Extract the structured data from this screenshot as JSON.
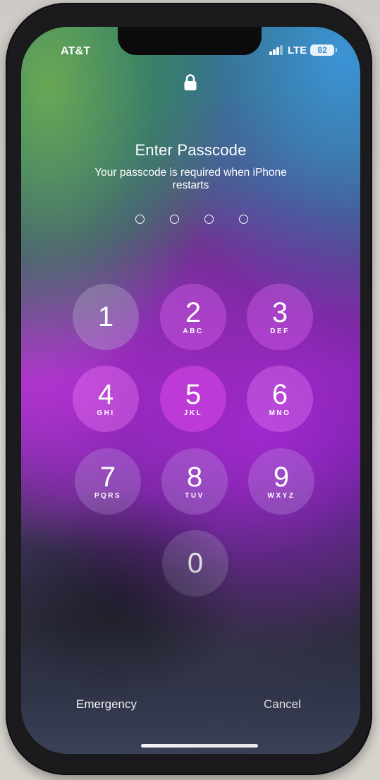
{
  "status_bar": {
    "carrier": "AT&T",
    "network": "LTE",
    "battery": "82"
  },
  "lock": {
    "icon": "lock-icon"
  },
  "prompt": {
    "title": "Enter Passcode",
    "subtitle": "Your passcode is required when iPhone restarts",
    "entered_digits": 0,
    "passcode_length": 4
  },
  "keypad": {
    "keys": [
      {
        "num": "1",
        "letters": ""
      },
      {
        "num": "2",
        "letters": "ABC"
      },
      {
        "num": "3",
        "letters": "DEF"
      },
      {
        "num": "4",
        "letters": "GHI"
      },
      {
        "num": "5",
        "letters": "JKL"
      },
      {
        "num": "6",
        "letters": "MNO"
      },
      {
        "num": "7",
        "letters": "PQRS"
      },
      {
        "num": "8",
        "letters": "TUV"
      },
      {
        "num": "9",
        "letters": "WXYZ"
      },
      {
        "num": "0",
        "letters": ""
      }
    ]
  },
  "footer": {
    "emergency_label": "Emergency",
    "cancel_label": "Cancel"
  }
}
